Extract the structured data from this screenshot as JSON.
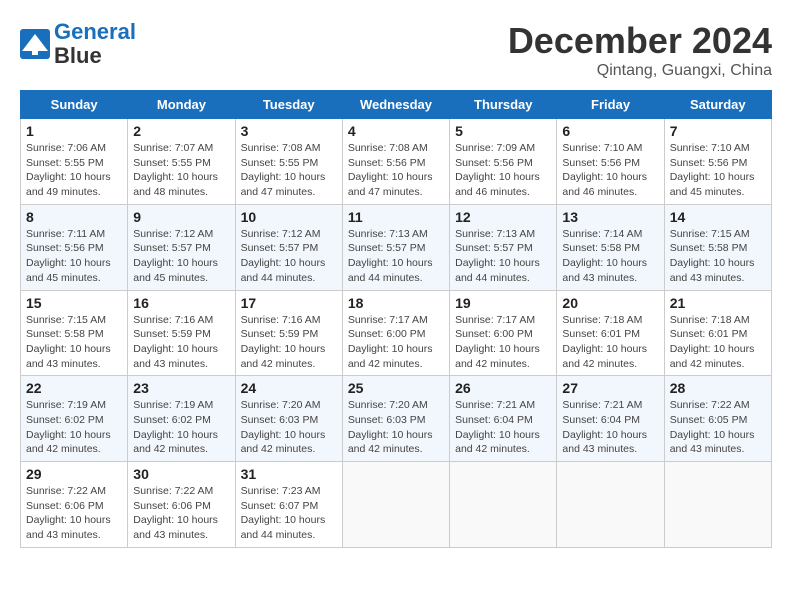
{
  "header": {
    "logo_line1": "General",
    "logo_line2": "Blue",
    "month": "December 2024",
    "location": "Qintang, Guangxi, China"
  },
  "weekdays": [
    "Sunday",
    "Monday",
    "Tuesday",
    "Wednesday",
    "Thursday",
    "Friday",
    "Saturday"
  ],
  "weeks": [
    [
      {
        "day": "1",
        "info": "Sunrise: 7:06 AM\nSunset: 5:55 PM\nDaylight: 10 hours\nand 49 minutes."
      },
      {
        "day": "2",
        "info": "Sunrise: 7:07 AM\nSunset: 5:55 PM\nDaylight: 10 hours\nand 48 minutes."
      },
      {
        "day": "3",
        "info": "Sunrise: 7:08 AM\nSunset: 5:55 PM\nDaylight: 10 hours\nand 47 minutes."
      },
      {
        "day": "4",
        "info": "Sunrise: 7:08 AM\nSunset: 5:56 PM\nDaylight: 10 hours\nand 47 minutes."
      },
      {
        "day": "5",
        "info": "Sunrise: 7:09 AM\nSunset: 5:56 PM\nDaylight: 10 hours\nand 46 minutes."
      },
      {
        "day": "6",
        "info": "Sunrise: 7:10 AM\nSunset: 5:56 PM\nDaylight: 10 hours\nand 46 minutes."
      },
      {
        "day": "7",
        "info": "Sunrise: 7:10 AM\nSunset: 5:56 PM\nDaylight: 10 hours\nand 45 minutes."
      }
    ],
    [
      {
        "day": "8",
        "info": "Sunrise: 7:11 AM\nSunset: 5:56 PM\nDaylight: 10 hours\nand 45 minutes."
      },
      {
        "day": "9",
        "info": "Sunrise: 7:12 AM\nSunset: 5:57 PM\nDaylight: 10 hours\nand 45 minutes."
      },
      {
        "day": "10",
        "info": "Sunrise: 7:12 AM\nSunset: 5:57 PM\nDaylight: 10 hours\nand 44 minutes."
      },
      {
        "day": "11",
        "info": "Sunrise: 7:13 AM\nSunset: 5:57 PM\nDaylight: 10 hours\nand 44 minutes."
      },
      {
        "day": "12",
        "info": "Sunrise: 7:13 AM\nSunset: 5:57 PM\nDaylight: 10 hours\nand 44 minutes."
      },
      {
        "day": "13",
        "info": "Sunrise: 7:14 AM\nSunset: 5:58 PM\nDaylight: 10 hours\nand 43 minutes."
      },
      {
        "day": "14",
        "info": "Sunrise: 7:15 AM\nSunset: 5:58 PM\nDaylight: 10 hours\nand 43 minutes."
      }
    ],
    [
      {
        "day": "15",
        "info": "Sunrise: 7:15 AM\nSunset: 5:58 PM\nDaylight: 10 hours\nand 43 minutes."
      },
      {
        "day": "16",
        "info": "Sunrise: 7:16 AM\nSunset: 5:59 PM\nDaylight: 10 hours\nand 43 minutes."
      },
      {
        "day": "17",
        "info": "Sunrise: 7:16 AM\nSunset: 5:59 PM\nDaylight: 10 hours\nand 42 minutes."
      },
      {
        "day": "18",
        "info": "Sunrise: 7:17 AM\nSunset: 6:00 PM\nDaylight: 10 hours\nand 42 minutes."
      },
      {
        "day": "19",
        "info": "Sunrise: 7:17 AM\nSunset: 6:00 PM\nDaylight: 10 hours\nand 42 minutes."
      },
      {
        "day": "20",
        "info": "Sunrise: 7:18 AM\nSunset: 6:01 PM\nDaylight: 10 hours\nand 42 minutes."
      },
      {
        "day": "21",
        "info": "Sunrise: 7:18 AM\nSunset: 6:01 PM\nDaylight: 10 hours\nand 42 minutes."
      }
    ],
    [
      {
        "day": "22",
        "info": "Sunrise: 7:19 AM\nSunset: 6:02 PM\nDaylight: 10 hours\nand 42 minutes."
      },
      {
        "day": "23",
        "info": "Sunrise: 7:19 AM\nSunset: 6:02 PM\nDaylight: 10 hours\nand 42 minutes."
      },
      {
        "day": "24",
        "info": "Sunrise: 7:20 AM\nSunset: 6:03 PM\nDaylight: 10 hours\nand 42 minutes."
      },
      {
        "day": "25",
        "info": "Sunrise: 7:20 AM\nSunset: 6:03 PM\nDaylight: 10 hours\nand 42 minutes."
      },
      {
        "day": "26",
        "info": "Sunrise: 7:21 AM\nSunset: 6:04 PM\nDaylight: 10 hours\nand 42 minutes."
      },
      {
        "day": "27",
        "info": "Sunrise: 7:21 AM\nSunset: 6:04 PM\nDaylight: 10 hours\nand 43 minutes."
      },
      {
        "day": "28",
        "info": "Sunrise: 7:22 AM\nSunset: 6:05 PM\nDaylight: 10 hours\nand 43 minutes."
      }
    ],
    [
      {
        "day": "29",
        "info": "Sunrise: 7:22 AM\nSunset: 6:06 PM\nDaylight: 10 hours\nand 43 minutes."
      },
      {
        "day": "30",
        "info": "Sunrise: 7:22 AM\nSunset: 6:06 PM\nDaylight: 10 hours\nand 43 minutes."
      },
      {
        "day": "31",
        "info": "Sunrise: 7:23 AM\nSunset: 6:07 PM\nDaylight: 10 hours\nand 44 minutes."
      },
      null,
      null,
      null,
      null
    ]
  ]
}
